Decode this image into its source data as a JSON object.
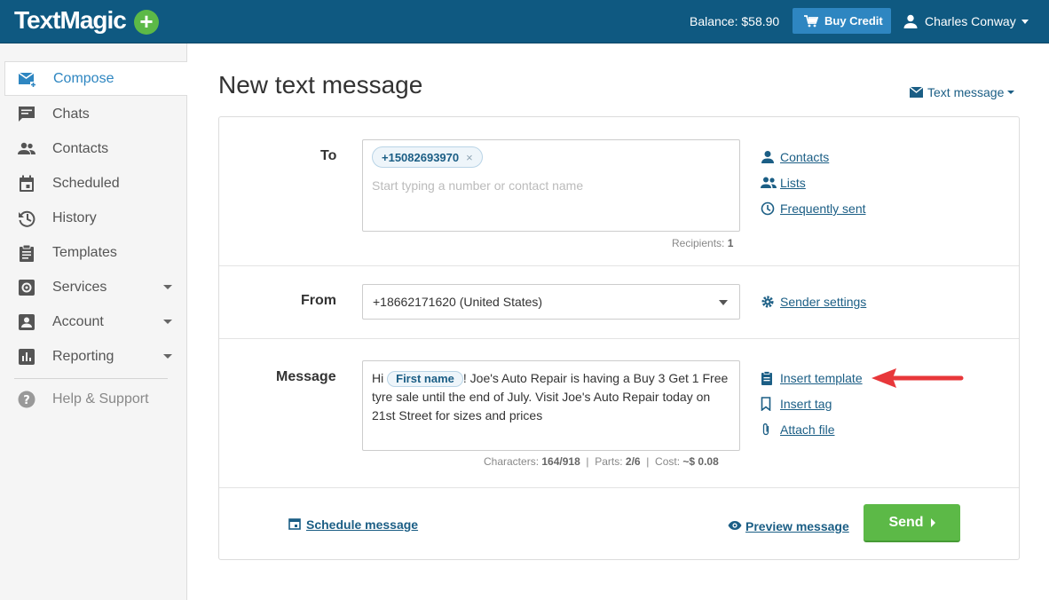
{
  "topbar": {
    "logo": "TextMagic",
    "balance": "Balance: $58.90",
    "buy_credit": "Buy Credit",
    "user_name": "Charles Conway"
  },
  "sidebar": {
    "items": [
      {
        "label": "Compose",
        "icon": "compose-icon",
        "active": true
      },
      {
        "label": "Chats",
        "icon": "chat-icon"
      },
      {
        "label": "Contacts",
        "icon": "contacts-icon"
      },
      {
        "label": "Scheduled",
        "icon": "calendar-icon"
      },
      {
        "label": "History",
        "icon": "history-icon"
      },
      {
        "label": "Templates",
        "icon": "clipboard-icon"
      },
      {
        "label": "Services",
        "icon": "gear-icon",
        "has_dropdown": true
      },
      {
        "label": "Account",
        "icon": "account-icon",
        "has_dropdown": true
      },
      {
        "label": "Reporting",
        "icon": "chart-icon",
        "has_dropdown": true
      }
    ],
    "help": "Help & Support"
  },
  "main": {
    "title": "New text message",
    "message_type": "Text message",
    "to": {
      "label": "To",
      "chip": "+15082693970",
      "chip_remove": "×",
      "placeholder": "Start typing a number or contact name",
      "recipients_label": "Recipients:",
      "recipients_count": "1",
      "links": [
        "Contacts",
        "Lists",
        "Frequently sent"
      ]
    },
    "from": {
      "label": "From",
      "value": "+18662171620 (United States)",
      "link": "Sender settings"
    },
    "message": {
      "label": "Message",
      "prefix": "Hi ",
      "tag": "First name",
      "body": "! Joe's Auto Repair is having a Buy 3 Get 1 Free tyre sale until the end of July. Visit Joe's Auto Repair today on 21st Street for sizes and prices",
      "characters_label": "Characters:",
      "characters": "164/918",
      "parts_label": "Parts:",
      "parts": "2/6",
      "cost_label": "Cost:",
      "cost": "~$ 0.08",
      "links": [
        "Insert template",
        "Insert tag",
        "Attach file"
      ]
    },
    "footer": {
      "schedule": "Schedule message",
      "preview": "Preview message",
      "send": "Send"
    }
  },
  "colors": {
    "topbar": "#0f5981",
    "accent": "#2e86c1",
    "link": "#1b5e85",
    "send": "#5cb947",
    "arrow": "#e8373a"
  }
}
